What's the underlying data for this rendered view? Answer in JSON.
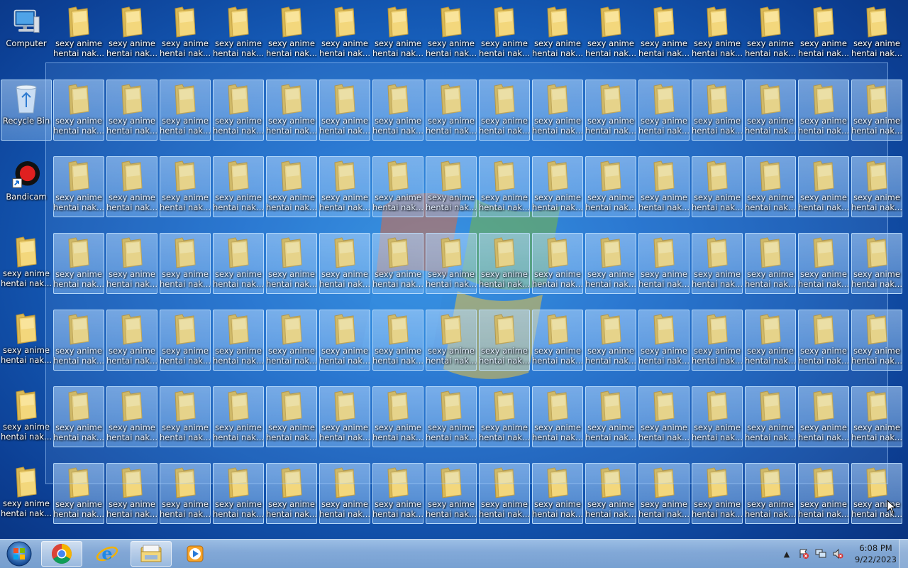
{
  "desktop": {
    "special_icons": [
      {
        "name": "computer",
        "label": "Computer",
        "icon": "computer-icon"
      },
      {
        "name": "recycle-bin",
        "label": "Recycle Bin",
        "icon": "recycle-bin-icon"
      },
      {
        "name": "bandicam",
        "label": "Bandicam",
        "icon": "bandicam-icon"
      }
    ],
    "folder_label_line1": "sexy anime",
    "folder_label_line2": "hentai nak...",
    "folder_icon": "folder-icon"
  },
  "taskbar": {
    "start_icon": "windows-start-icon",
    "pinned": [
      {
        "name": "chrome",
        "icon": "chrome-icon"
      },
      {
        "name": "internet-explorer",
        "icon": "internet-explorer-icon"
      },
      {
        "name": "windows-explorer",
        "icon": "windows-explorer-icon",
        "active": true
      },
      {
        "name": "media-player",
        "icon": "media-player-icon"
      }
    ],
    "tray": {
      "icons": [
        "show-hidden-icons-icon",
        "action-center-icon",
        "network-icon",
        "volume-icon"
      ],
      "time": "6:08 PM",
      "date": "9/22/2023"
    }
  },
  "colors": {
    "desktop_blue": "#1e6fcc",
    "folder_yellow": "#f3d77c",
    "selection": "#b4d8ff"
  }
}
